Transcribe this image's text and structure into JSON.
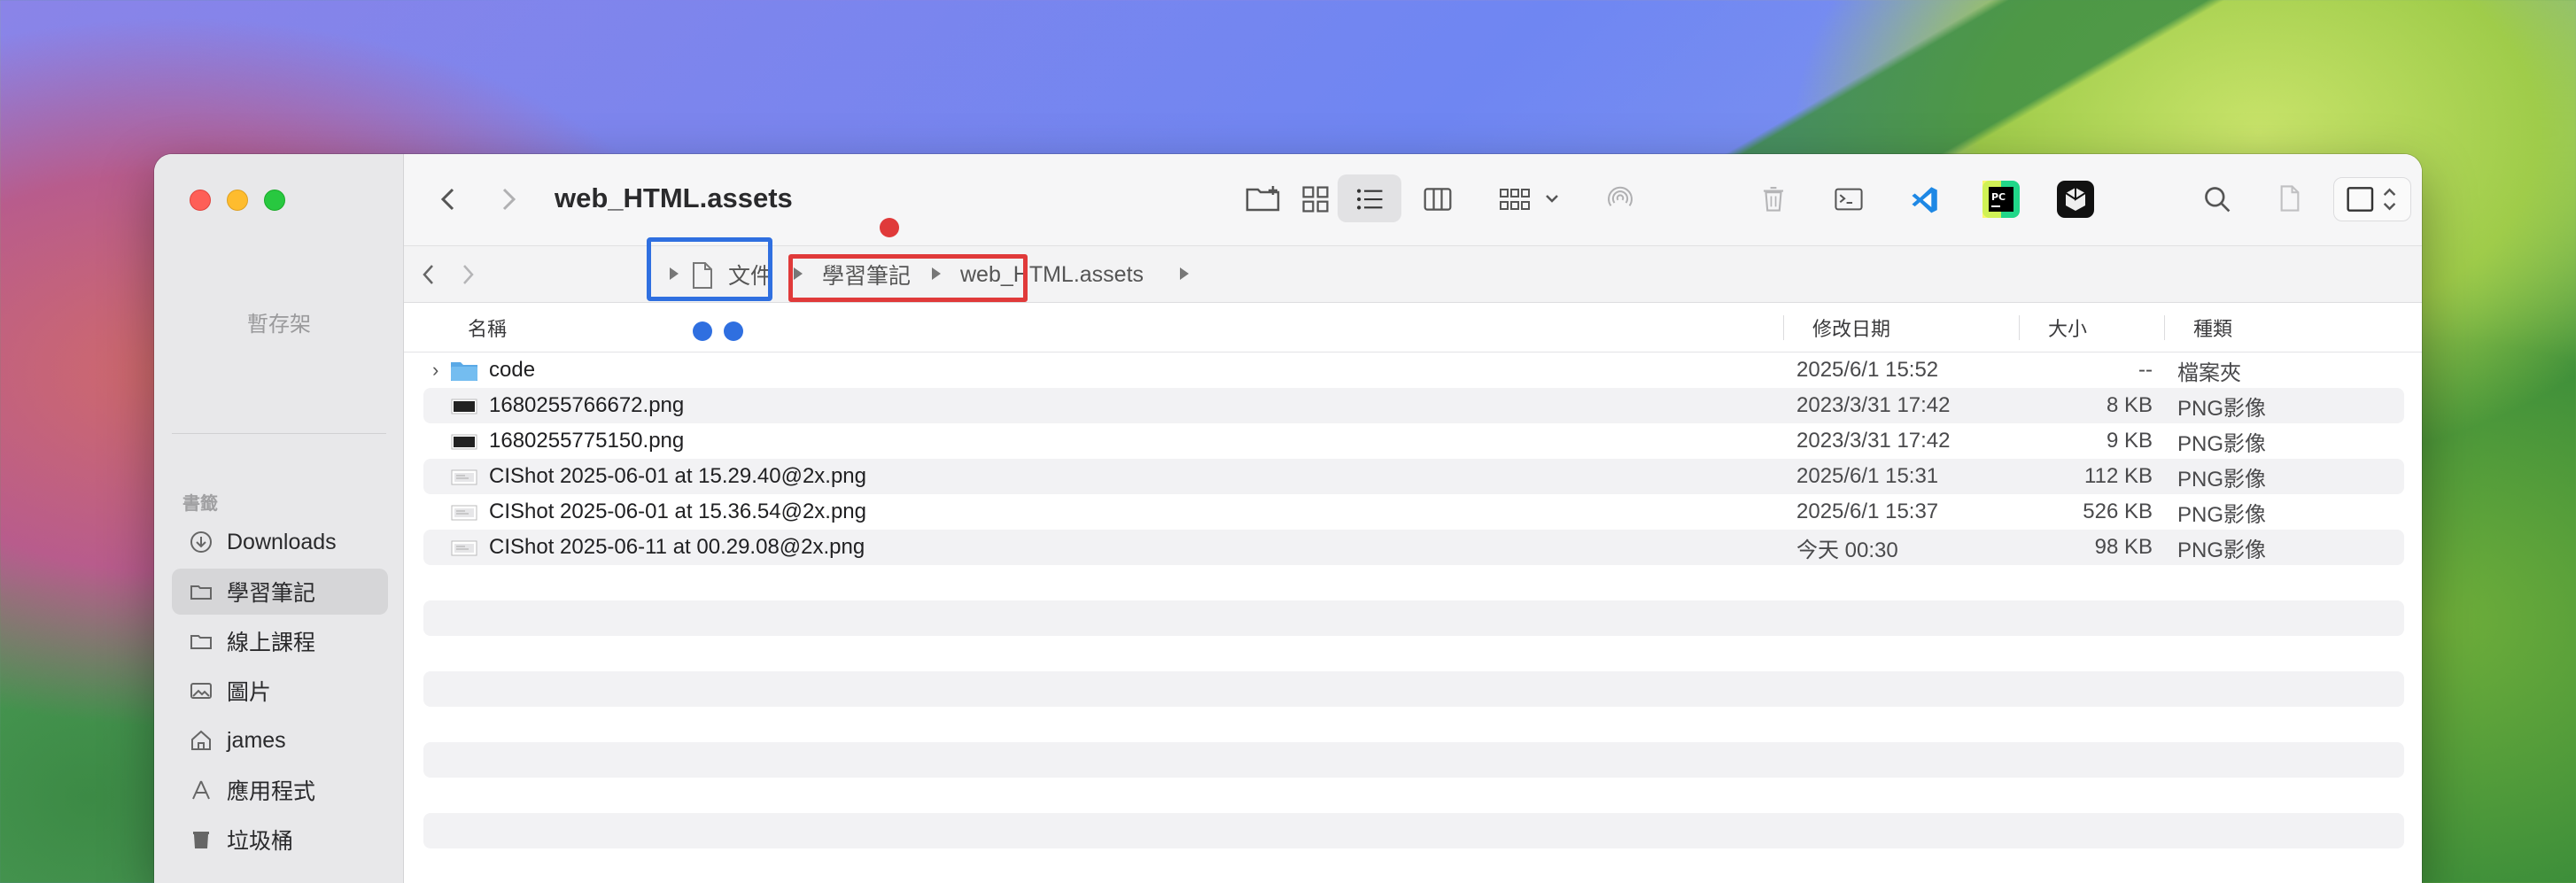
{
  "window": {
    "title": "web_HTML.assets"
  },
  "sidebar": {
    "shelf_label": "暫存架",
    "section_label": "書籤",
    "items": [
      {
        "label": "Downloads",
        "icon": "download-icon"
      },
      {
        "label": "學習筆記",
        "icon": "folder-icon",
        "active": true
      },
      {
        "label": "線上課程",
        "icon": "folder-icon"
      },
      {
        "label": "圖片",
        "icon": "photo-icon"
      },
      {
        "label": "james",
        "icon": "home-icon"
      },
      {
        "label": "應用程式",
        "icon": "apps-icon"
      },
      {
        "label": "垃圾桶",
        "icon": "trash-icon"
      }
    ]
  },
  "pathbar": {
    "items": [
      "文件",
      "學習筆記",
      "web_HTML.assets"
    ]
  },
  "columns": {
    "name": "名稱",
    "date": "修改日期",
    "size": "大小",
    "kind": "種類"
  },
  "files": [
    {
      "name": "code",
      "date": "2025/6/1 15:52",
      "size": "--",
      "kind": "檔案夾",
      "type": "folder"
    },
    {
      "name": "1680255766672.png",
      "date": "2023/3/31 17:42",
      "size": "8 KB",
      "kind": "PNG影像",
      "type": "image-dark"
    },
    {
      "name": "1680255775150.png",
      "date": "2023/3/31 17:42",
      "size": "9 KB",
      "kind": "PNG影像",
      "type": "image-dark"
    },
    {
      "name": "CIShot 2025-06-01 at 15.29.40@2x.png",
      "date": "2025/6/1 15:31",
      "size": "112 KB",
      "kind": "PNG影像",
      "type": "image-light"
    },
    {
      "name": "CIShot 2025-06-01 at 15.36.54@2x.png",
      "date": "2025/6/1 15:37",
      "size": "526 KB",
      "kind": "PNG影像",
      "type": "image-light"
    },
    {
      "name": "CIShot 2025-06-11 at 00.29.08@2x.png",
      "date": "今天 00:30",
      "size": "98 KB",
      "kind": "PNG影像",
      "type": "image-light"
    }
  ],
  "colors": {
    "annotation_blue": "#2f6fe0",
    "annotation_red": "#e03a3a"
  }
}
